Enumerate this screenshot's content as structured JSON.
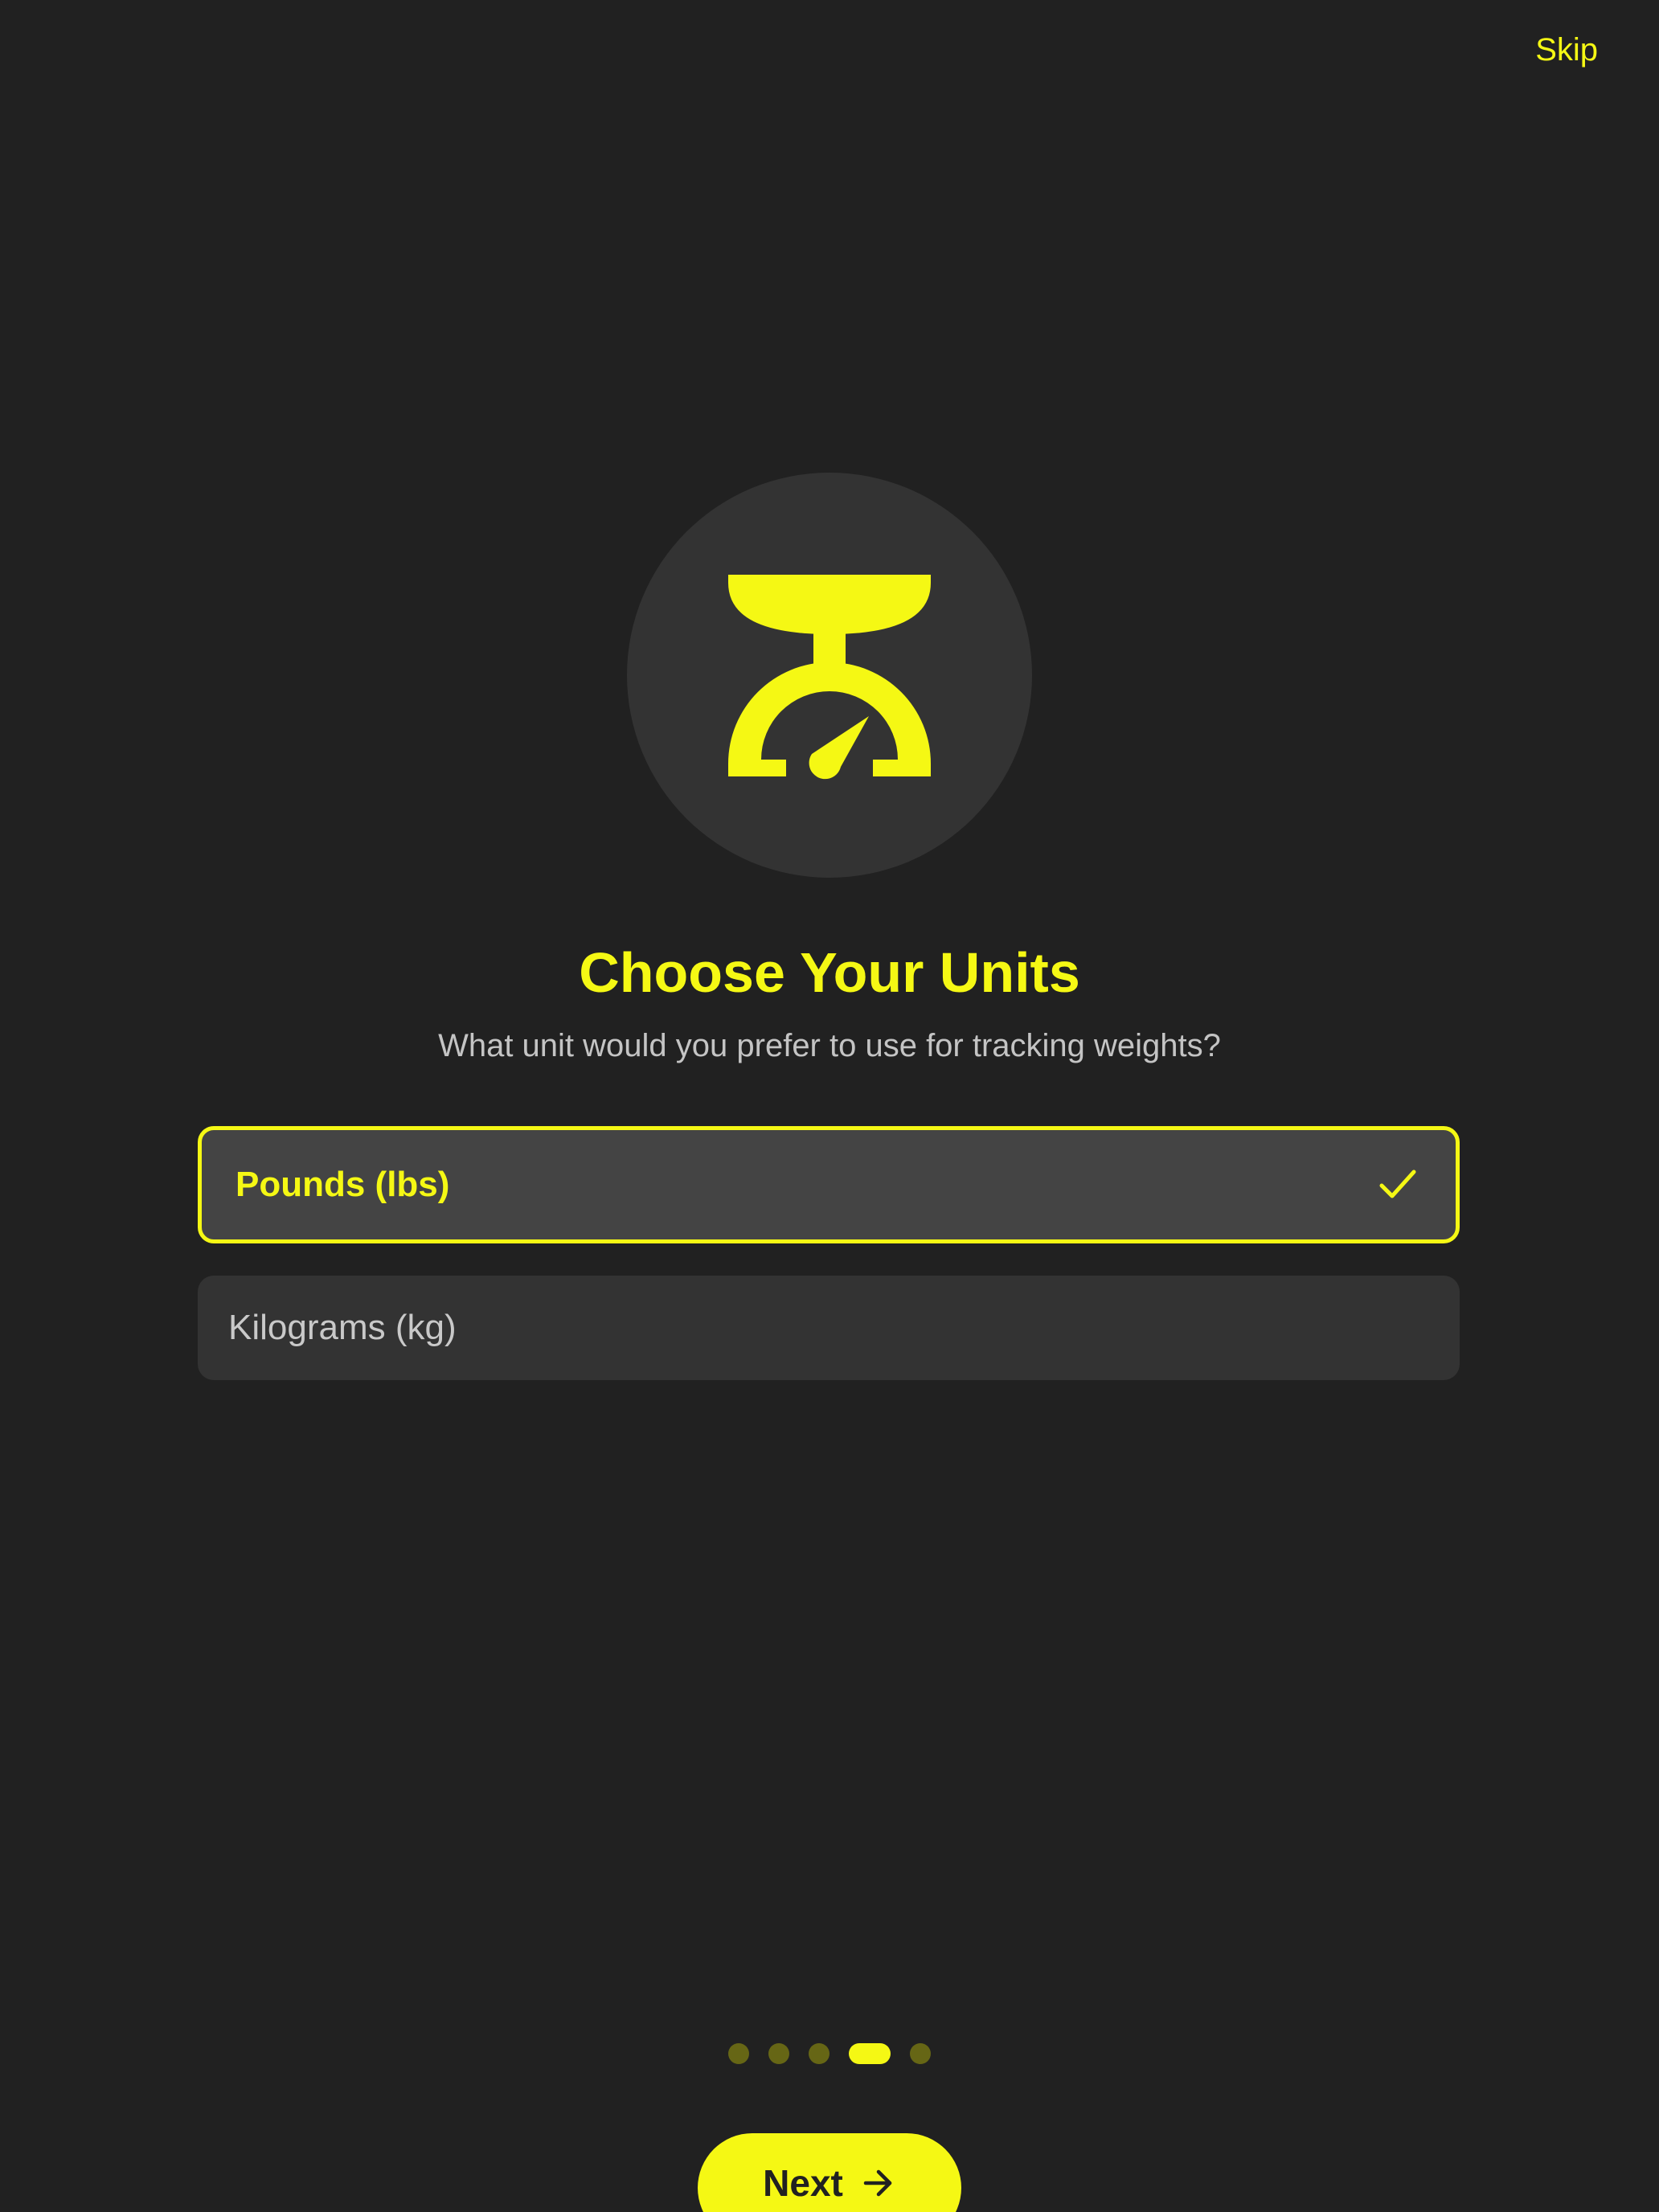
{
  "header": {
    "skip_label": "Skip"
  },
  "hero": {
    "icon": "scale-icon",
    "title": "Choose Your Units",
    "subtitle": "What unit would you prefer to use for tracking weights?"
  },
  "options": [
    {
      "label": "Pounds (lbs)",
      "selected": true
    },
    {
      "label": "Kilograms (kg)",
      "selected": false
    }
  ],
  "pager": {
    "total": 5,
    "current": 4
  },
  "footer": {
    "next_label": "Next",
    "next_icon": "arrow-right-icon"
  },
  "colors": {
    "background": "#212121",
    "accent": "#F5F814",
    "card": "#333333",
    "card_selected": "#444444",
    "dot_inactive": "#666615"
  }
}
